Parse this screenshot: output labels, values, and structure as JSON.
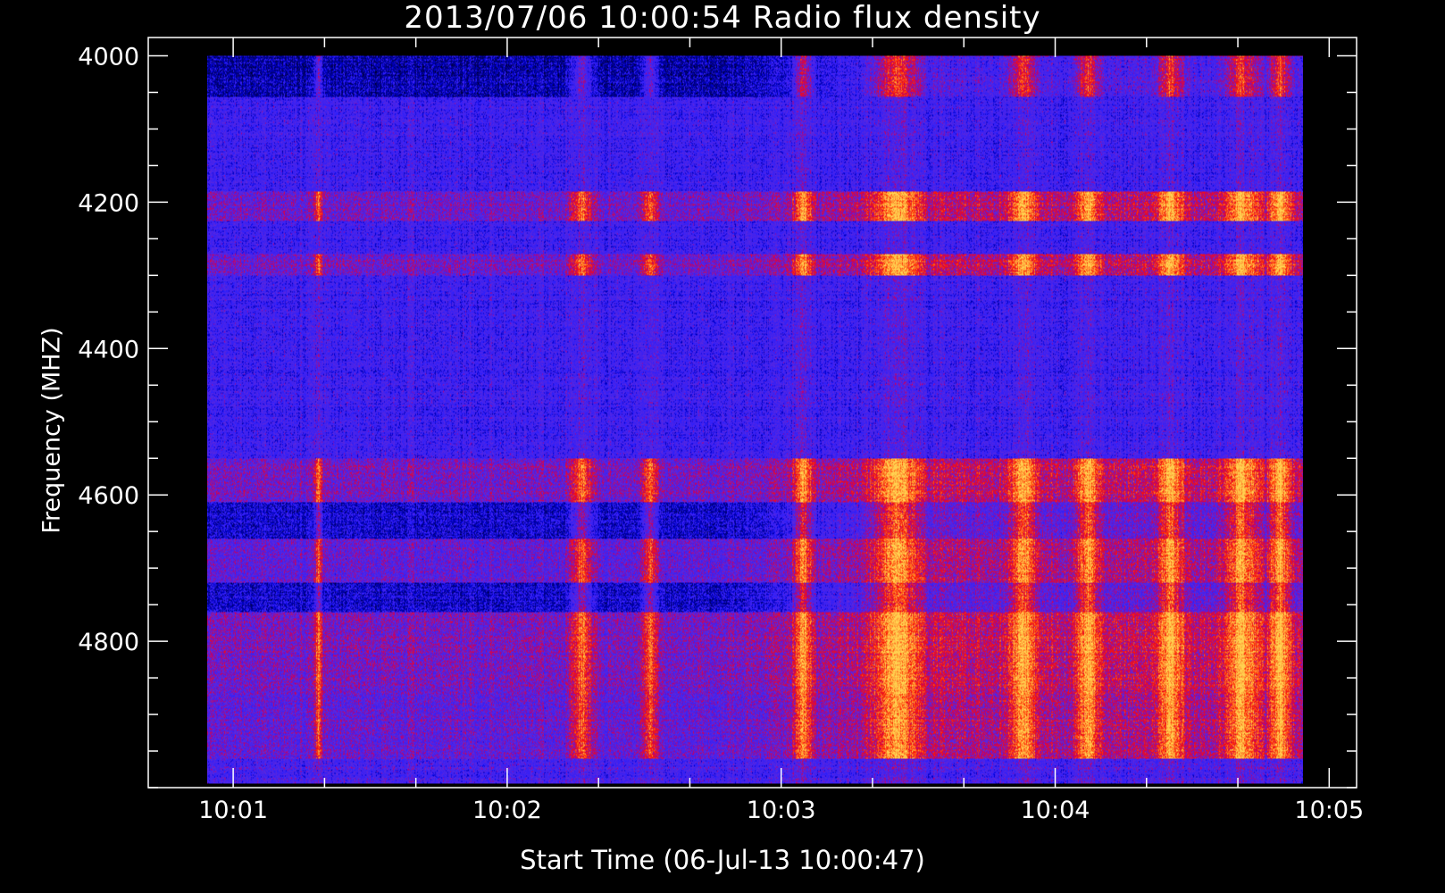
{
  "chart_data": {
    "type": "heatmap",
    "title": "2013/07/06 10:00:54 Radio flux density",
    "xlabel": "Start Time (06-Jul-13 10:00:47)",
    "ylabel": "Frequency (MHZ)",
    "x_major_ticks": [
      {
        "value": 1.0,
        "label": "10:01"
      },
      {
        "value": 2.0,
        "label": "10:02"
      },
      {
        "value": 3.0,
        "label": "10:03"
      },
      {
        "value": 4.0,
        "label": "10:04"
      },
      {
        "value": 5.0,
        "label": "10:05"
      }
    ],
    "x_minor_step": 0.333333,
    "x_range": [
      0.69,
      5.1
    ],
    "data_x_range": [
      0.905,
      4.905
    ],
    "y_major_ticks": [
      {
        "value": 4000,
        "label": "4000"
      },
      {
        "value": 4200,
        "label": "4200"
      },
      {
        "value": 4400,
        "label": "4400"
      },
      {
        "value": 4600,
        "label": "4600"
      },
      {
        "value": 4800,
        "label": "4800"
      }
    ],
    "y_minor_step": 50,
    "y_range": [
      3975,
      5000
    ],
    "data_y_range": [
      4000,
      4995
    ],
    "y_inverted": true,
    "colors": {
      "background": "#000000",
      "axes": "#ffffff",
      "low": "#000000",
      "mid": "#2020ff",
      "high": "#ff2000",
      "peak": "#ffd060"
    },
    "horizontal_bands": [
      {
        "freq_min": 4000,
        "freq_max": 4055,
        "level": "dark-with-emission"
      },
      {
        "freq_min": 4055,
        "freq_max": 4185,
        "level": "blue"
      },
      {
        "freq_min": 4185,
        "freq_max": 4225,
        "level": "striated-emission"
      },
      {
        "freq_min": 4225,
        "freq_max": 4270,
        "level": "blue"
      },
      {
        "freq_min": 4270,
        "freq_max": 4300,
        "level": "striated-emission"
      },
      {
        "freq_min": 4300,
        "freq_max": 4550,
        "level": "blue"
      },
      {
        "freq_min": 4550,
        "freq_max": 4610,
        "level": "striated-emission"
      },
      {
        "freq_min": 4610,
        "freq_max": 4660,
        "level": "mixed"
      },
      {
        "freq_min": 4660,
        "freq_max": 4720,
        "level": "emission"
      },
      {
        "freq_min": 4720,
        "freq_max": 4760,
        "level": "mixed"
      },
      {
        "freq_min": 4760,
        "freq_max": 4870,
        "level": "strong-emission"
      },
      {
        "freq_min": 4870,
        "freq_max": 4960,
        "level": "emission"
      },
      {
        "freq_min": 4960,
        "freq_max": 4995,
        "level": "blue-edge"
      }
    ],
    "bright_time_columns": [
      {
        "time": 1.31,
        "width": 0.02
      },
      {
        "time": 2.27,
        "width": 0.06
      },
      {
        "time": 2.52,
        "width": 0.04
      },
      {
        "time": 3.08,
        "width": 0.05
      },
      {
        "time": 3.42,
        "width": 0.12
      },
      {
        "time": 3.88,
        "width": 0.07
      },
      {
        "time": 4.12,
        "width": 0.06
      },
      {
        "time": 4.42,
        "width": 0.07
      },
      {
        "time": 4.68,
        "width": 0.09
      },
      {
        "time": 4.82,
        "width": 0.06
      }
    ]
  }
}
